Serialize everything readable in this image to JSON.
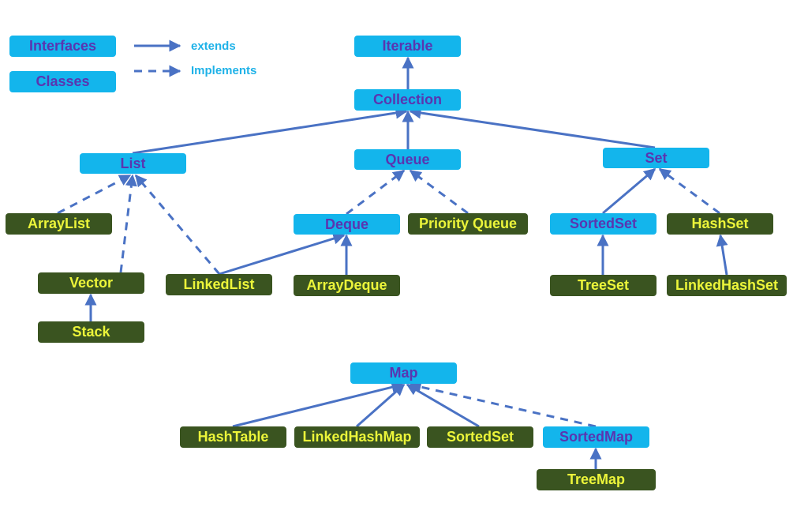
{
  "legend": {
    "interfaces_label": "Interfaces",
    "classes_label": "Classes",
    "extends_label": "extends",
    "implements_label": "Implements"
  },
  "colors": {
    "interface_fill": "#13b5ec",
    "interface_text": "#5a35b0",
    "class_fill": "#3a5420",
    "class_text": "#ecf53a",
    "edge": "#4a72c4",
    "legend_text": "#1fb2e8"
  },
  "nodes": {
    "iterable": {
      "label": "Iterable",
      "kind": "interface"
    },
    "collection": {
      "label": "Collection",
      "kind": "interface"
    },
    "list": {
      "label": "List",
      "kind": "interface"
    },
    "queue": {
      "label": "Queue",
      "kind": "interface"
    },
    "set": {
      "label": "Set",
      "kind": "interface"
    },
    "arraylist": {
      "label": "ArrayList",
      "kind": "class"
    },
    "vector": {
      "label": "Vector",
      "kind": "class"
    },
    "stack": {
      "label": "Stack",
      "kind": "class"
    },
    "linkedlist": {
      "label": "LinkedList",
      "kind": "class"
    },
    "deque": {
      "label": "Deque",
      "kind": "interface"
    },
    "priorityqueue": {
      "label": "Priority Queue",
      "kind": "class"
    },
    "arraydeque": {
      "label": "ArrayDeque",
      "kind": "class"
    },
    "sortedset": {
      "label": "SortedSet",
      "kind": "interface"
    },
    "hashset": {
      "label": "HashSet",
      "kind": "class"
    },
    "treeset": {
      "label": "TreeSet",
      "kind": "class"
    },
    "linkedhashset": {
      "label": "LinkedHashSet",
      "kind": "class"
    },
    "map": {
      "label": "Map",
      "kind": "interface"
    },
    "hashtable": {
      "label": "HashTable",
      "kind": "class"
    },
    "linkedhashmap": {
      "label": "LinkedHashMap",
      "kind": "class"
    },
    "sortedset_map": {
      "label": "SortedSet",
      "kind": "class"
    },
    "sortedmap": {
      "label": "SortedMap",
      "kind": "interface"
    },
    "treemap": {
      "label": "TreeMap",
      "kind": "class"
    }
  },
  "edges": [
    {
      "from": "collection",
      "to": "iterable",
      "type": "extends"
    },
    {
      "from": "list",
      "to": "collection",
      "type": "extends"
    },
    {
      "from": "queue",
      "to": "collection",
      "type": "extends"
    },
    {
      "from": "set",
      "to": "collection",
      "type": "extends"
    },
    {
      "from": "arraylist",
      "to": "list",
      "type": "implements"
    },
    {
      "from": "vector",
      "to": "list",
      "type": "implements"
    },
    {
      "from": "linkedlist",
      "to": "list",
      "type": "implements"
    },
    {
      "from": "stack",
      "to": "vector",
      "type": "extends"
    },
    {
      "from": "linkedlist",
      "to": "deque",
      "type": "extends"
    },
    {
      "from": "deque",
      "to": "queue",
      "type": "implements"
    },
    {
      "from": "priorityqueue",
      "to": "queue",
      "type": "implements"
    },
    {
      "from": "arraydeque",
      "to": "deque",
      "type": "extends"
    },
    {
      "from": "sortedset",
      "to": "set",
      "type": "extends"
    },
    {
      "from": "hashset",
      "to": "set",
      "type": "implements"
    },
    {
      "from": "treeset",
      "to": "sortedset",
      "type": "extends"
    },
    {
      "from": "linkedhashset",
      "to": "hashset",
      "type": "extends"
    },
    {
      "from": "hashtable",
      "to": "map",
      "type": "extends"
    },
    {
      "from": "linkedhashmap",
      "to": "map",
      "type": "extends"
    },
    {
      "from": "sortedset_map",
      "to": "map",
      "type": "extends"
    },
    {
      "from": "sortedmap",
      "to": "map",
      "type": "implements"
    },
    {
      "from": "treemap",
      "to": "sortedmap",
      "type": "extends"
    }
  ]
}
